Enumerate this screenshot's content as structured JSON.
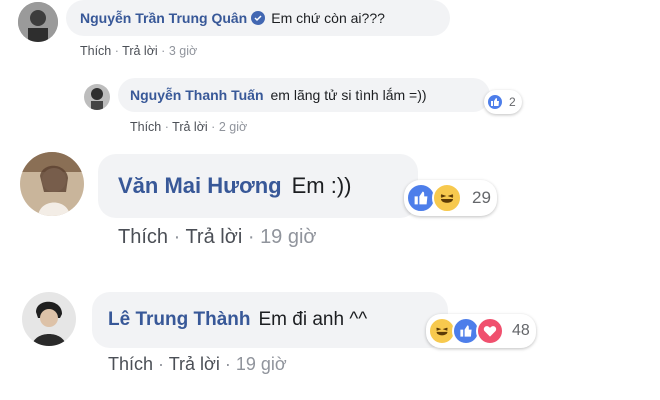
{
  "comments": [
    {
      "author": "Nguyễn Trần Trung Quân",
      "text": "Em chứ còn ai???",
      "actions": [
        "Thích",
        "Trả lời",
        "3 giờ"
      ]
    },
    {
      "author": "Nguyễn Thanh Tuấn",
      "text": "em lãng tử si tình lắm =))",
      "reaction_count": "2",
      "actions": [
        "Thích",
        "Trả lời",
        "2 giờ"
      ]
    },
    {
      "author": "Văn Mai Hương",
      "text": "Em :))",
      "reaction_count": "29",
      "actions": [
        "Thích",
        "Trả lời",
        "19 giờ"
      ]
    },
    {
      "author": "Lê Trung Thành",
      "text": "Em đi anh ^^",
      "reaction_count": "48",
      "actions": [
        "Thích",
        "Trả lời",
        "19 giờ"
      ]
    }
  ],
  "colors": {
    "author": "#385898",
    "bubble": "#f2f3f5",
    "like": "#4d7eea",
    "haha": "#f7c94e",
    "love": "#f0506e"
  }
}
